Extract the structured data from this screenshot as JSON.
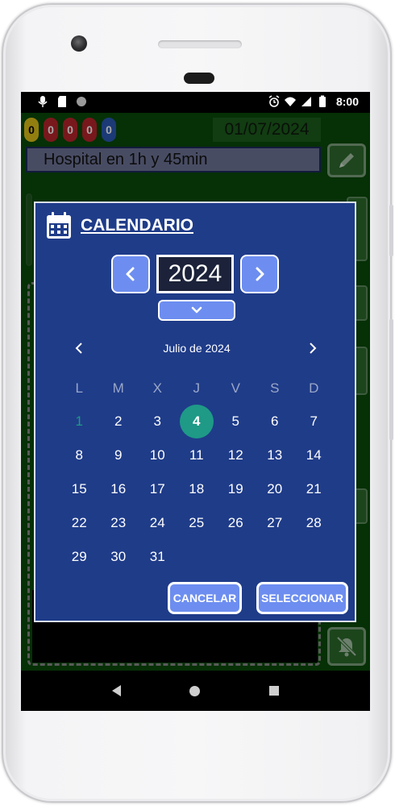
{
  "statusbar": {
    "time": "8:00",
    "left_icons": [
      "mic-icon",
      "sd-card-icon",
      "circle-icon"
    ],
    "right_icons": [
      "alarm-icon",
      "wifi-icon",
      "signal-icon",
      "battery-icon"
    ]
  },
  "app": {
    "counters": [
      "0",
      "0",
      "0",
      "0",
      "0"
    ],
    "counter_colors": [
      "#e1c21a",
      "#b8262b",
      "#b8262b",
      "#b8262b",
      "#2a5ab5"
    ],
    "date": "01/07/2024",
    "message": "Hospital en 1h y 45min"
  },
  "dialog": {
    "title": "CALENDARIO",
    "year": "2024",
    "month_label": "Julio de 2024",
    "weekdays": [
      "L",
      "M",
      "X",
      "J",
      "V",
      "S",
      "D"
    ],
    "days": [
      "1",
      "2",
      "3",
      "4",
      "5",
      "6",
      "7",
      "8",
      "9",
      "10",
      "11",
      "12",
      "13",
      "14",
      "15",
      "16",
      "17",
      "18",
      "19",
      "20",
      "21",
      "22",
      "23",
      "24",
      "25",
      "26",
      "27",
      "28",
      "29",
      "30",
      "31"
    ],
    "today_day": "1",
    "selected_day": "4",
    "cancel_label": "CANCELAR",
    "select_label": "SELECCIONAR",
    "accent_color": "#1e9a87",
    "button_color": "#6d8ef0",
    "background_color": "#1f3c89"
  }
}
